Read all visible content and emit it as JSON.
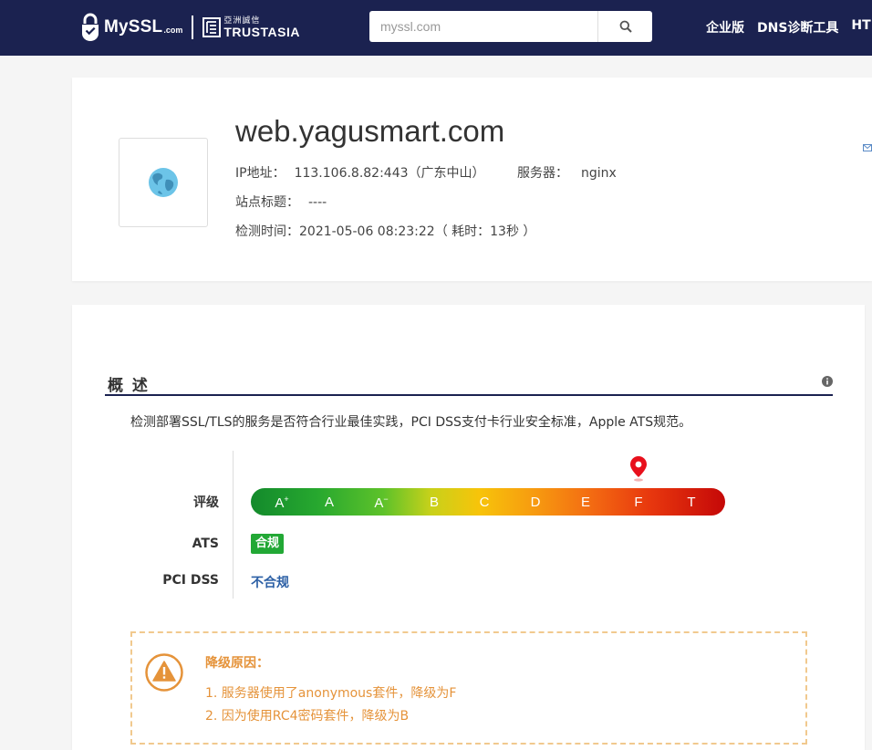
{
  "header": {
    "logo_text": "MySSL",
    "logo_suffix": ".com",
    "partner_cn": "亞洲誠信",
    "partner_en": "TRUSTASIA",
    "search_placeholder": "myssl.com",
    "nav": [
      "企业版",
      "DNS诊断工具",
      "HT"
    ]
  },
  "site": {
    "domain": "web.yagusmart.com",
    "ip_label": "IP地址：",
    "ip_value": "113.106.8.82:443（广东中山）",
    "server_label": "服务器：",
    "server_value": "nginx",
    "title_label": "站点标题：",
    "title_value": "----",
    "time_label": "检测时间：",
    "time_value": "2021-05-06 08:23:22（ 耗时：13秒 ）"
  },
  "overview": {
    "section_title": "概 述",
    "description": "检测部署SSL/TLS的服务是否符合行业最佳实践，PCI DSS支付卡行业安全标准，Apple ATS规范。",
    "rating_label": "评级",
    "grades": [
      "A",
      "A",
      "A",
      "B",
      "C",
      "D",
      "E",
      "F",
      "T"
    ],
    "grade_marks": [
      "+",
      "",
      "−",
      "",
      "",
      "",
      "",
      "",
      ""
    ],
    "current_grade": "F",
    "ats_label": "ATS",
    "ats_value": "合规",
    "pci_label": "PCI DSS",
    "pci_value": "不合规",
    "downgrade_title": "降级原因：",
    "downgrade_reasons": [
      "1. 服务器使用了anonymous套件，降级为F",
      "2. 因为使用RC4密码套件，降级为B"
    ]
  },
  "colors": {
    "header_bg": "#1b2250",
    "ats_ok": "#22a835",
    "pci_fail": "#2b5fa5",
    "warning": "#e5933a",
    "pin": "#e8101c"
  }
}
